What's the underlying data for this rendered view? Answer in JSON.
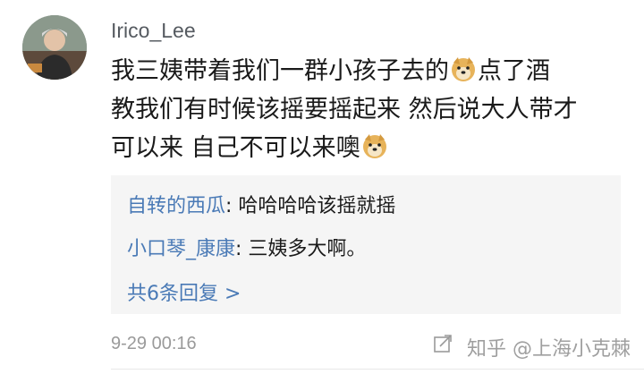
{
  "comment": {
    "username": "Irico_Lee",
    "text_line1_a": "我三姨带着我们一群小孩子去的",
    "emoji_1": "doge-emoji",
    "text_line1_b": "点了酒",
    "text_line2": "教我们有时候该摇要摇起来  然后说大人带才",
    "text_line3": "可以来 自己不可以来噢",
    "emoji_2": "doge-emoji",
    "timestamp": "9-29 00:16"
  },
  "replies": [
    {
      "author": "自转的西瓜",
      "sep": ": ",
      "text": "哈哈哈哈该摇就摇"
    },
    {
      "author": "小口琴_康康",
      "sep": ": ",
      "text": "三姨多大啊。"
    }
  ],
  "more_replies": "共6条回复 >",
  "watermark": "知乎 @上海小克棘",
  "colors": {
    "link": "#4a7ab6",
    "reply_bg": "#f5f5f5",
    "meta": "#9a9a9a"
  },
  "icons": {
    "share": "share-icon"
  }
}
